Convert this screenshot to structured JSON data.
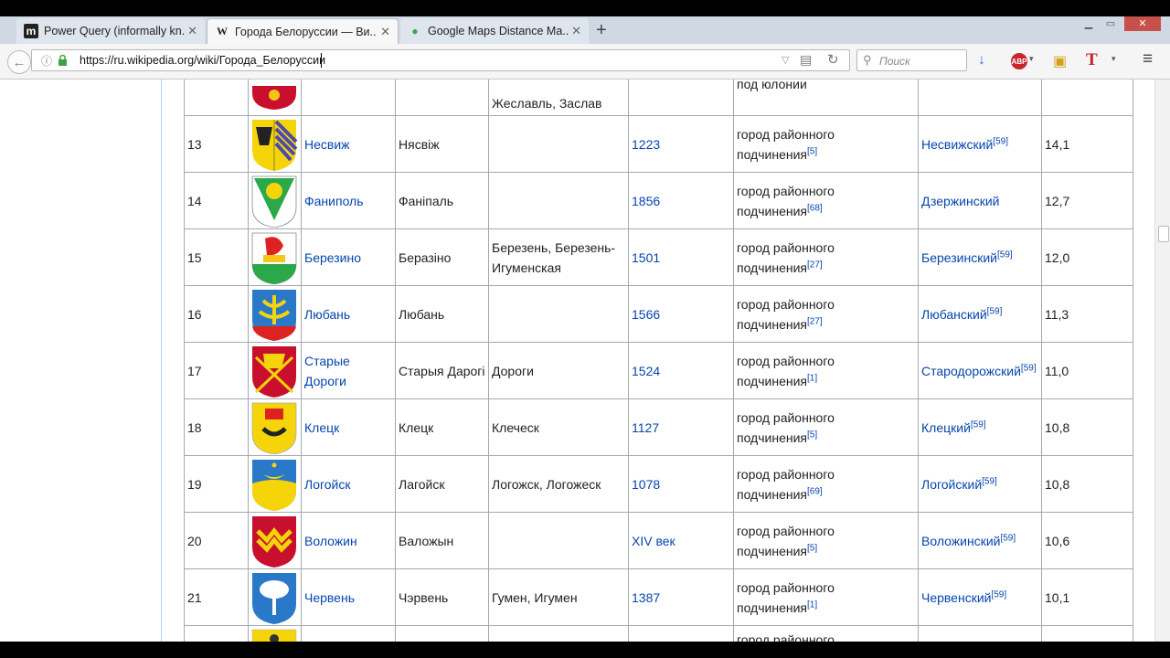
{
  "browser": {
    "tabs": [
      {
        "icon": "m",
        "title": "Power Query (informally kn..."
      },
      {
        "icon": "W",
        "title": "Города Белоруссии — Ви..."
      },
      {
        "icon": "●",
        "title": "Google Maps Distance Ma..."
      }
    ],
    "new_tab": "+",
    "url": "https://ru.wikipedia.org/wiki/Города_Белоруссии",
    "search_placeholder": "Поиск"
  },
  "table": {
    "top_partial": {
      "old_names": "Жеславль, Заслав",
      "status": "под юлонии"
    },
    "rows": [
      {
        "num": "13",
        "name": "Несвиж",
        "bel": "Нясвіж",
        "old": "",
        "year": "1223",
        "status": "город районного подчинения",
        "status_ref": "[5]",
        "district": "Несвижский",
        "district_ref": "[59]",
        "pop": "14,1"
      },
      {
        "num": "14",
        "name": "Фаниполь",
        "bel": "Фаніпаль",
        "old": "",
        "year": "1856",
        "status": "город районного подчинения",
        "status_ref": "[68]",
        "district": "Дзержинский",
        "district_ref": "",
        "pop": "12,7"
      },
      {
        "num": "15",
        "name": "Березино",
        "bel": "Беразіно",
        "old": "Березень, Березень-Игуменская",
        "year": "1501",
        "status": "город районного подчинения",
        "status_ref": "[27]",
        "district": "Березинский",
        "district_ref": "[59]",
        "pop": "12,0"
      },
      {
        "num": "16",
        "name": "Любань",
        "bel": "Любань",
        "old": "",
        "year": "1566",
        "status": "город районного подчинения",
        "status_ref": "[27]",
        "district": "Любанский",
        "district_ref": "[59]",
        "pop": "11,3"
      },
      {
        "num": "17",
        "name": "Старые Дороги",
        "bel": "Старыя Дарогі",
        "old": "Дороги",
        "year": "1524",
        "status": "город районного подчинения",
        "status_ref": "[1]",
        "district": "Стародорожский",
        "district_ref": "[59]",
        "pop": "11,0"
      },
      {
        "num": "18",
        "name": "Клецк",
        "bel": "Клецк",
        "old": "Клеческ",
        "year": "1127",
        "status": "город районного подчинения",
        "status_ref": "[5]",
        "district": "Клецкий",
        "district_ref": "[59]",
        "pop": "10,8"
      },
      {
        "num": "19",
        "name": "Логойск",
        "bel": "Лагойск",
        "old": "Логожск, Логожеск",
        "year": "1078",
        "status": "город районного подчинения",
        "status_ref": "[69]",
        "district": "Логойский",
        "district_ref": "[59]",
        "pop": "10,8"
      },
      {
        "num": "20",
        "name": "Воложин",
        "bel": "Валожын",
        "old": "",
        "year": "XIV век",
        "status": "город районного подчинения",
        "status_ref": "[5]",
        "district": "Воложинский",
        "district_ref": "[59]",
        "pop": "10,6"
      },
      {
        "num": "21",
        "name": "Червень",
        "bel": "Чэрвень",
        "old": "Гумен, Игумен",
        "year": "1387",
        "status": "город районного подчинения",
        "status_ref": "[1]",
        "district": "Червенский",
        "district_ref": "[59]",
        "pop": "10,1"
      }
    ],
    "bottom_partial": {
      "status": "город районного"
    }
  }
}
